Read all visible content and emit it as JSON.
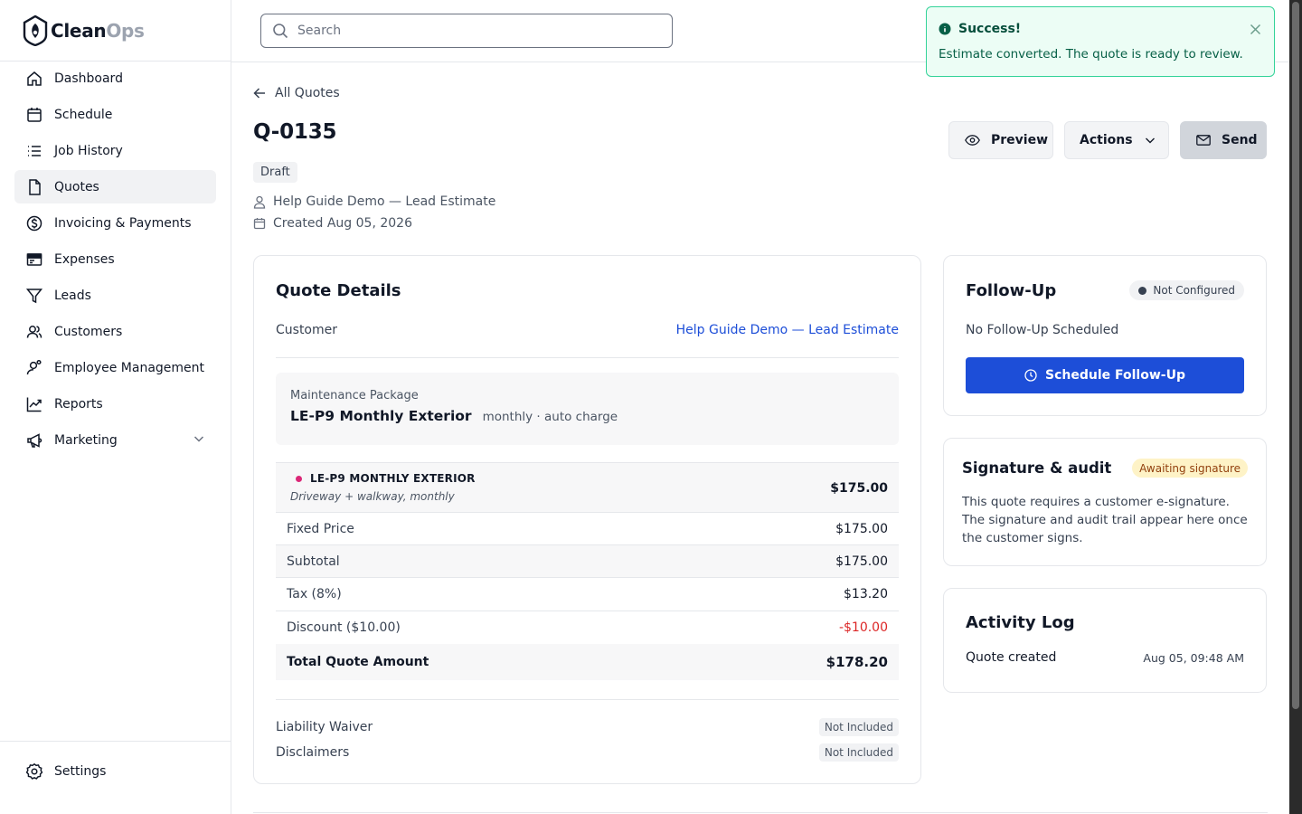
{
  "brand": {
    "name_part1": "Clean",
    "name_part2": "Ops"
  },
  "sidebar": {
    "items": [
      {
        "label": "Dashboard",
        "icon": "home-icon"
      },
      {
        "label": "Schedule",
        "icon": "calendar-icon"
      },
      {
        "label": "Job History",
        "icon": "list-icon"
      },
      {
        "label": "Quotes",
        "icon": "document-icon",
        "active": true
      },
      {
        "label": "Invoicing & Payments",
        "icon": "dollar-circle-icon"
      },
      {
        "label": "Expenses",
        "icon": "receipt-icon"
      },
      {
        "label": "Leads",
        "icon": "filter-icon"
      },
      {
        "label": "Customers",
        "icon": "users-icon"
      },
      {
        "label": "Employee Management",
        "icon": "user-gear-icon"
      },
      {
        "label": "Reports",
        "icon": "chart-line-icon"
      },
      {
        "label": "Marketing",
        "icon": "megaphone-icon",
        "expandable": true
      }
    ],
    "settings_label": "Settings"
  },
  "header": {
    "search_placeholder": "Search"
  },
  "toast": {
    "title": "Success!",
    "message": "Estimate converted. The quote is ready to review.",
    "color": "#10b981"
  },
  "quote": {
    "back_label": "All Quotes",
    "number": "Q-0135",
    "status": "Draft",
    "customer_line": "Help Guide Demo — Lead Estimate",
    "created_line": "Created Aug 05, 2026",
    "actions": {
      "preview": "Preview",
      "actions": "Actions",
      "send": "Send"
    }
  },
  "details": {
    "title": "Quote Details",
    "customer_label": "Customer",
    "customer_value": "Help Guide Demo — Lead Estimate",
    "package": {
      "label": "Maintenance Package",
      "name": "LE-P9 Monthly Exterior",
      "desc": "monthly · auto charge"
    },
    "line_item": {
      "name": "LE-P9 MONTHLY EXTERIOR",
      "desc": "Driveway + walkway, monthly",
      "amount": "$175.00"
    },
    "rows": [
      {
        "label": "Fixed Price",
        "value": "$175.00"
      },
      {
        "label": "Subtotal",
        "value": "$175.00"
      },
      {
        "label": "Tax (8%)",
        "value": "$13.20"
      },
      {
        "label": "Discount ($10.00)",
        "value": "-$10.00"
      }
    ],
    "total": {
      "label": "Total Quote Amount",
      "value": "$178.20"
    },
    "extras": [
      {
        "label": "Liability Waiver",
        "value": "Not Included"
      },
      {
        "label": "Disclaimers",
        "value": "Not Included"
      }
    ]
  },
  "followup": {
    "title": "Follow-Up",
    "status": "Not Configured",
    "text": "No Follow-Up Scheduled",
    "button": "Schedule Follow-Up"
  },
  "signature": {
    "title": "Signature & audit",
    "status": "Awaiting signature",
    "text": "This quote requires a customer e-signature. The signature and audit trail appear here once the customer signs."
  },
  "activity": {
    "title": "Activity Log",
    "entries": [
      {
        "label": "Quote created",
        "time": "Aug 05, 09:48 AM"
      }
    ]
  },
  "colors": {
    "primary": "#1d4ed8",
    "danger": "#dc2626",
    "accent_dot": "#db2777",
    "warning_bg": "#fef3c7"
  }
}
